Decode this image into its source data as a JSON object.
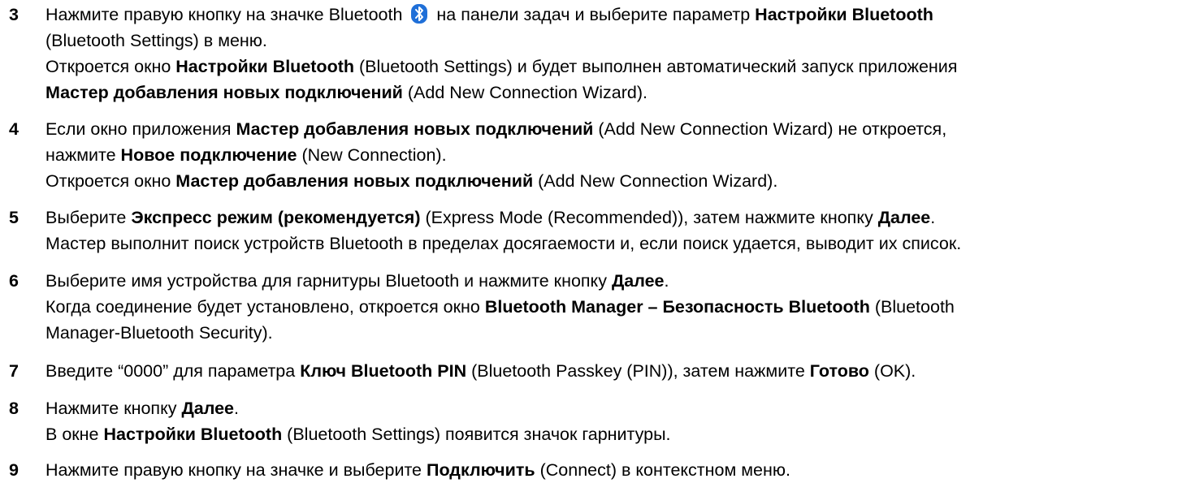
{
  "steps": [
    {
      "number": "3",
      "lines": [
        [
          "Нажмите правую кнопку на значке Bluetooth ",
          {
            "icon": "bluetooth-icon"
          },
          " на панели задач и выберите параметр ",
          {
            "b": "Настройки Bluetooth"
          }
        ],
        [
          "(Bluetooth Settings) в меню."
        ],
        [
          "Откроется окно ",
          {
            "b": "Настройки Bluetooth"
          },
          " (Bluetooth Settings) и будет выполнен автоматический запуск приложения"
        ],
        [
          {
            "b": "Мастер добавления новых подключений"
          },
          " (Add New Connection Wizard)."
        ]
      ]
    },
    {
      "number": "4",
      "lines": [
        [
          "Если окно приложения ",
          {
            "b": "Мастер добавления новых подключений"
          },
          " (Add New Connection Wizard) не откроется,"
        ],
        [
          "нажмите ",
          {
            "b": "Новое подключение"
          },
          " (New Connection)."
        ],
        [
          "Откроется окно ",
          {
            "b": "Мастер добавления новых подключений"
          },
          " (Add New Connection Wizard)."
        ]
      ]
    },
    {
      "number": "5",
      "lines": [
        [
          "Выберите ",
          {
            "b": "Экспресс режим (рекомендуется)"
          },
          " (Express Mode (Recommended)), затем нажмите кнопку ",
          {
            "b": "Далее"
          },
          "."
        ],
        [
          "Мастер выполнит поиск устройств Bluetooth в пределах досягаемости и, если поиск удается, выводит их список."
        ]
      ]
    },
    {
      "number": "6",
      "lines": [
        [
          "Выберите имя устройства для гарнитуры Bluetooth и нажмите кнопку ",
          {
            "b": "Далее"
          },
          "."
        ],
        [
          "Когда соединение будет установлено, откроется окно ",
          {
            "b": "Bluetooth Manager – Безопасность Bluetooth"
          },
          " (Bluetooth"
        ],
        [
          "Manager-Bluetooth Security)."
        ]
      ]
    },
    {
      "number": "7",
      "lines": [
        [
          "Введите “0000” для параметра ",
          {
            "b": "Ключ Bluetooth PIN"
          },
          " (Bluetooth Passkey (PIN)), затем нажмите ",
          {
            "b": "Готово"
          },
          " (OK)."
        ]
      ]
    },
    {
      "number": "8",
      "lines": [
        [
          "Нажмите кнопку ",
          {
            "b": "Далее"
          },
          "."
        ],
        [
          "В окне ",
          {
            "b": "Настройки Bluetooth"
          },
          " (Bluetooth Settings) появится значок гарнитуры."
        ]
      ]
    },
    {
      "number": "9",
      "lines": [
        [
          "Нажмите правую кнопку на значке и выберите ",
          {
            "b": "Подключить"
          },
          " (Connect) в контекстном меню."
        ]
      ]
    }
  ],
  "colors": {
    "text": "#000000",
    "bluetooth_icon_bg": "#1f6fd8",
    "bluetooth_icon_mark": "#ffffff"
  }
}
